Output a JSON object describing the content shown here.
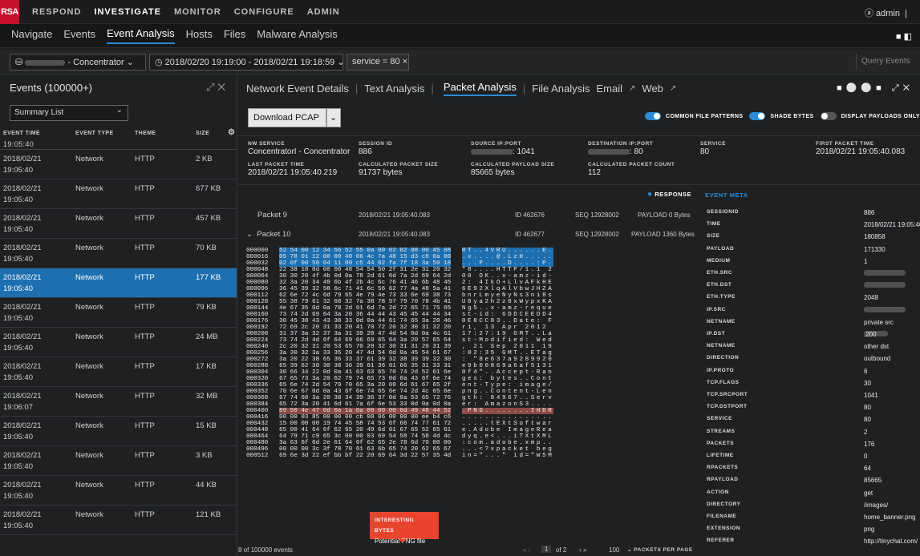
{
  "topbar": {
    "logo": "RSA",
    "nav": [
      "RESPOND",
      "INVESTIGATE",
      "MONITOR",
      "CONFIGURE",
      "ADMIN"
    ],
    "active": "INVESTIGATE",
    "user": "admin"
  },
  "subnav": {
    "items": [
      "Navigate",
      "Events",
      "Event Analysis",
      "Hosts",
      "Files",
      "Malware Analysis"
    ],
    "active": "Event Analysis"
  },
  "filter": {
    "service": "- Concentrator",
    "time_range": "2018/02/20 19:19:00 - 2018/02/21 19:18:59",
    "query": "service = 80",
    "query_button": "Query Events"
  },
  "events": {
    "title": "Events (100000+)",
    "list_type": "Summary List",
    "columns": [
      "EVENT TIME",
      "EVENT TYPE",
      "THEME",
      "SIZE"
    ],
    "first_time": "19:05:40",
    "rows": [
      {
        "date": "2018/02/21",
        "time": "19:05:40",
        "type": "Network",
        "theme": "HTTP",
        "size": "2 KB"
      },
      {
        "date": "2018/02/21",
        "time": "19:05:40",
        "type": "Network",
        "theme": "HTTP",
        "size": "677 KB"
      },
      {
        "date": "2018/02/21",
        "time": "19:05:40",
        "type": "Network",
        "theme": "HTTP",
        "size": "457 KB"
      },
      {
        "date": "2018/02/21",
        "time": "19:05:40",
        "type": "Network",
        "theme": "HTTP",
        "size": "70 KB"
      },
      {
        "date": "2018/02/21",
        "time": "19:05:40",
        "type": "Network",
        "theme": "HTTP",
        "size": "177 KB"
      },
      {
        "date": "2018/02/21",
        "time": "19:05:40",
        "type": "Network",
        "theme": "HTTP",
        "size": "79 KB"
      },
      {
        "date": "2018/02/21",
        "time": "19:05:40",
        "type": "Network",
        "theme": "HTTP",
        "size": "24 MB"
      },
      {
        "date": "2018/02/21",
        "time": "19:05:40",
        "type": "Network",
        "theme": "HTTP",
        "size": "17 KB"
      },
      {
        "date": "2018/02/21",
        "time": "19:06:07",
        "type": "Network",
        "theme": "HTTP",
        "size": "32 MB"
      },
      {
        "date": "2018/02/21",
        "time": "19:05:40",
        "type": "Network",
        "theme": "HTTP",
        "size": "15 KB"
      },
      {
        "date": "2018/02/21",
        "time": "19:05:40",
        "type": "Network",
        "theme": "HTTP",
        "size": "3 KB"
      },
      {
        "date": "2018/02/21",
        "time": "19:05:40",
        "type": "Network",
        "theme": "HTTP",
        "size": "44 KB"
      },
      {
        "date": "2018/02/21",
        "time": "19:05:40",
        "type": "Network",
        "theme": "HTTP",
        "size": "121 KB"
      }
    ],
    "selected_index": 4
  },
  "analysis": {
    "tabs": [
      "Network Event Details",
      "Text Analysis",
      "Packet Analysis",
      "File Analysis",
      "Email",
      "Web"
    ],
    "active": "Packet Analysis",
    "download": "Download PCAP",
    "toggles": [
      "COMMON FILE PATTERNS",
      "SHADE BYTES",
      "DISPLAY PAYLOADS ONLY"
    ]
  },
  "summary": {
    "nw_service_label": "NW SERVICE",
    "nw_service": "ConcentratorI - Concentrator",
    "session_label": "SESSION ID",
    "session": "886",
    "src_label": "SOURCE IP:PORT",
    "src": ": 1041",
    "dst_label": "DESTINATION IP:PORT",
    "dst": ": 80",
    "svc_label": "SERVICE",
    "svc": "80",
    "first_label": "FIRST PACKET TIME",
    "first": "2018/02/21 19:05:40.083",
    "last_label": "LAST PACKET TIME",
    "last": "2018/02/21 19:05:40.219",
    "cps_label": "CALCULATED PACKET SIZE",
    "cps": "91737 bytes",
    "cpls_label": "CALCULATED PAYLOAD SIZE",
    "cpls": "85665 bytes",
    "cpc_label": "CALCULATED PACKET COUNT",
    "cpc": "112"
  },
  "packets": {
    "response": "RESPONSE",
    "p9": {
      "name": "Packet 9",
      "time": "2018/02/21 19:05:40.083",
      "id": "ID 462676",
      "seq": "SEQ 12928002",
      "payload": "PAYLOAD 0 Bytes"
    },
    "p10": {
      "name": "Packet 10",
      "time": "2018/02/21 19:05:40.083",
      "id": "ID 462677",
      "seq": "SEQ 12928002",
      "payload": "PAYLOAD 1360 Bytes"
    },
    "tooltip_title": "INTERESTING BYTES",
    "tooltip_text": "Potential PNG file",
    "footer_count": "8 of 100000 events",
    "page": "1",
    "of": "of 2",
    "per_page": "100",
    "per_page_label": "PACKETS PER PAGE"
  },
  "meta": {
    "title": "EVENT META",
    "rows": [
      [
        "SESSIONID",
        "886"
      ],
      [
        "TIME",
        "2018/02/21 19:05:40"
      ],
      [
        "SIZE",
        "180858"
      ],
      [
        "PAYLOAD",
        "171330"
      ],
      [
        "MEDIUM",
        "1"
      ],
      [
        "ETH.SRC",
        ""
      ],
      [
        "ETH.DST",
        ""
      ],
      [
        "ETH.TYPE",
        "2048"
      ],
      [
        "IP.SRC",
        ""
      ],
      [
        "NETNAME",
        "private src"
      ],
      [
        "IP.DST",
        ".200"
      ],
      [
        "NETNAME",
        "other dst"
      ],
      [
        "DIRECTION",
        "outbound"
      ],
      [
        "IP.PROTO",
        "6"
      ],
      [
        "TCP.FLAGS",
        "30"
      ],
      [
        "TCP.SRCPORT",
        "1041"
      ],
      [
        "TCP.DSTPORT",
        "80"
      ],
      [
        "SERVICE",
        "80"
      ],
      [
        "STREAMS",
        "2"
      ],
      [
        "PACKETS",
        "176"
      ],
      [
        "LIFETIME",
        "0"
      ],
      [
        "RPACKETS",
        "64"
      ],
      [
        "RPAYLOAD",
        "85665"
      ],
      [
        "ACTION",
        "get"
      ],
      [
        "DIRECTORY",
        "/images/"
      ],
      [
        "FILENAME",
        "home_banner.png"
      ],
      [
        "EXTENSION",
        "png"
      ],
      [
        "REFERER",
        "http://tinychat.com/"
      ]
    ]
  },
  "hex": [
    [
      "000000",
      "52 54 00 12 34 56 52 55 0a 00 02 02 08 00 45 08",
      "RT..4VRU......E."
    ],
    [
      "000016",
      "05 78 01 12 00 00 40 06 4c 7a 48 15 d3 c8 0a 00",
      ".x....@.LzH....."
    ],
    [
      "000032",
      "02 0f 00 50 04 11 00 c5 44 02 fa 7f 18 3a 50 18",
      "...P....D....:P."
    ],
    [
      "000048",
      "22 38 18 0d 00 00 48 54 54 50 2f 31 2e 31 20 32",
      "\"8....HTTP/1.1 2"
    ],
    [
      "000064",
      "30 30 20 4f 4b 0d 0a 78 2d 61 6d 7a 2d 69 64 2d",
      "00 OK..x-amz-id-"
    ],
    [
      "000080",
      "32 3a 20 34 49 6b 4f 2b 4c 6c 76 41 46 6b 48 45",
      "2: 4IkO+LlvAFkHE"
    ],
    [
      "000096",
      "36 45 39 32 58 6c 71 41 6c 56 62 77 4a 48 5a 41",
      "6E92XlqAlVbwJHZA"
    ],
    [
      "000112",
      "62 6e 72 4c 6d 79 65 4e 79 4e 73 33 6e 69 38 73",
      "bnrLmyeNyNs3ni8s"
    ],
    [
      "000128",
      "55 38 79 61 32 68 32 7a 38 78 57 79 70 78 4b 41",
      "U8ya2h2z8xWypxKA"
    ],
    [
      "000144",
      "4e 67 35 0d 0a 78 2d 61 6d 7a 2d 72 65 71 75 65",
      "Ng5..x-amz-reque"
    ],
    [
      "000160",
      "73 74 2d 69 64 3a 20 36 44 44 43 45 45 44 44 34",
      "st-id: 6DDCEEDD4"
    ],
    [
      "000176",
      "30 45 38 43 43 38 33 0d 0a 44 61 74 65 3a 20 46",
      "0E8CC83..Date: F"
    ],
    [
      "000192",
      "72 69 2c 20 31 33 20 41 70 72 20 32 30 31 32 20",
      "ri, 13 Apr 2012 "
    ],
    [
      "000208",
      "31 37 3a 32 37 3a 31 39 20 47 4d 54 0d 0a 4c 61",
      "17:27:19 GMT..La"
    ],
    [
      "000224",
      "73 74 2d 4d 6f 64 69 66 69 65 64 3a 20 57 65 64",
      "st-Modified: Wed"
    ],
    [
      "000240",
      "2c 20 32 31 20 53 65 70 20 32 30 31 31 20 31 39",
      ", 21 Sep 2011 19"
    ],
    [
      "000256",
      "3a 30 32 3a 33 35 20 47 4d 54 0d 0a 45 54 61 67",
      ":02:35 GMT..ETag"
    ],
    [
      "000272",
      "3a 20 22 38 65 36 33 37 61 39 32 38 39 39 32 30",
      ": \"8e637a9289920"
    ],
    [
      "000288",
      "65 39 62 30 30 38 36 39 61 36 61 66 35 31 33 31",
      "e9b00869a6af5131"
    ],
    [
      "000304",
      "30 66 34 22 0d 0a 41 63 63 65 70 74 2d 52 61 6e",
      "0f4\"..Accept-Ran"
    ],
    [
      "000320",
      "67 65 73 3a 20 62 79 74 65 73 0d 0a 43 6f 6e 74",
      "ges: bytes..Cont"
    ],
    [
      "000336",
      "65 6e 74 2d 54 79 70 65 3a 20 69 6d 61 67 65 2f",
      "ent-Type: image/"
    ],
    [
      "000352",
      "70 6e 67 0d 0a 43 6f 6e 74 65 6e 74 2d 4c 65 6e",
      "png..Content-Len"
    ],
    [
      "000368",
      "67 74 68 3a 20 38 34 39 36 37 0d 0a 53 65 72 76",
      "gth: 84967..Serv"
    ],
    [
      "000384",
      "65 72 3a 20 41 6d 61 7a 6f 6e 53 33 0d 0a 0d 0a",
      "er: AmazonS3...."
    ],
    [
      "000400",
      "89 50 4e 47 0d 0a 1a 0a 00 00 00 0d 49 48 44 52",
      ".PNG........IHDR"
    ],
    [
      "000416",
      "00 00 03 85 00 00 00 cb 08 06 00 00 00 ee b4 c6",
      "................"
    ],
    [
      "000432",
      "15 00 00 00 19 74 45 58 74 53 6f 66 74 77 61 72",
      ".....tEXtSoftwar"
    ],
    [
      "000448",
      "65 00 41 64 6f 62 65 20 49 6d 61 67 65 52 65 61",
      "e.Adobe ImageRea"
    ],
    [
      "000464",
      "64 79 71 c9 65 3c 00 00 03 69 54 58 74 58 4d 4c",
      "dyq.e<...iTXtXML"
    ],
    [
      "000480",
      "3a 63 6f 6d 2e 61 64 6f 62 65 2e 78 6d 70 00 00",
      ":com.adobe.xmp.."
    ],
    [
      "000496",
      "00 00 00 3c 3f 78 70 61 63 6b 65 74 20 62 65 67",
      "...<?xpacket beg"
    ],
    [
      "000512",
      "69 6e 3d 22 ef bb bf 22 20 69 64 3d 22 57 35 4d",
      "in=\"...\" id=\"W5M"
    ]
  ]
}
